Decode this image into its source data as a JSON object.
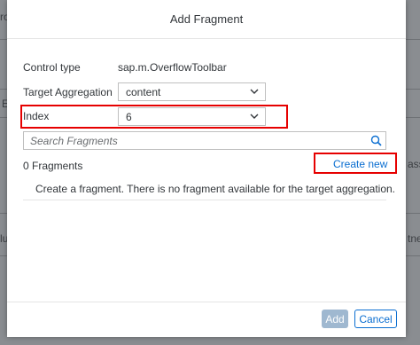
{
  "dialog": {
    "title": "Add Fragment",
    "control_type_label": "Control type",
    "control_type_value": "sap.m.OverflowToolbar",
    "target_aggregation_label": "Target Aggregation",
    "target_aggregation_value": "content",
    "index_label": "Index",
    "index_value": "6",
    "search_placeholder": "Search Fragments",
    "fragments_count": "0 Fragments",
    "create_new_label": "Create new",
    "empty_message": "Create a fragment. There is no fragment available for the target aggregation.",
    "add_button": "Add",
    "cancel_button": "Cancel"
  },
  "background": {
    "fragment_left_1": "ro",
    "fragment_left_2": "E",
    "fragment_left_3": "lu",
    "fragment_right_1": "asse",
    "fragment_right_2": "tne"
  },
  "colors": {
    "accent": "#0a6ed1",
    "highlight_box": "#e60000",
    "disabled_button": "#9fb8d0"
  }
}
